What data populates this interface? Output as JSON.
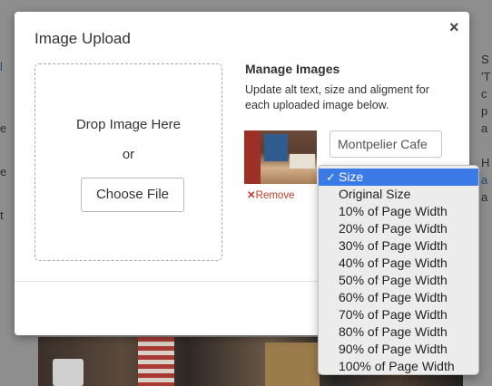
{
  "modal": {
    "title": "Image Upload",
    "close": "×",
    "drop_text": "Drop Image Here",
    "or_text": "or",
    "choose_file": "Choose File",
    "manage_title": "Manage Images",
    "manage_desc": "Update alt text, size and aligment for each uploaded image below.",
    "alt_value": "Montpelier Cafe",
    "remove": "Remove",
    "remove_icon": "✕"
  },
  "dropdown": {
    "selected": "Size",
    "check": "✓",
    "options": [
      "Original Size",
      "10% of Page Width",
      "20% of Page Width",
      "30% of Page Width",
      "40% of Page Width",
      "50% of Page Width",
      "60% of Page Width",
      "70% of Page Width",
      "80% of Page Width",
      "90% of Page Width",
      "100% of Page Width"
    ]
  },
  "background": {
    "right_text": [
      "S",
      "'T",
      "c",
      "p",
      "a",
      "",
      "H",
      "a",
      "a"
    ],
    "accent_link": "#1f4c7a",
    "selected_color": "#3b79e7",
    "remove_color": "#c0392b"
  }
}
